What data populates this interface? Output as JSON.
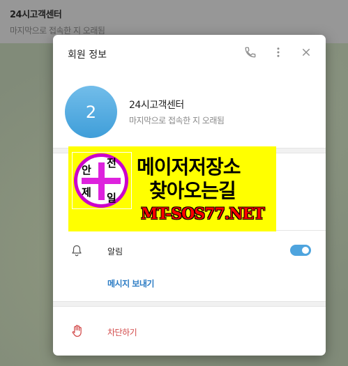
{
  "chat_header": {
    "title": "24시고객센터",
    "status": "마지막으로 접속한 지 오래됨"
  },
  "dialog": {
    "title": "회원 정보",
    "icons": {
      "phone": "phone-icon",
      "more": "more-vertical-icon",
      "close": "close-icon"
    }
  },
  "profile": {
    "avatar_initial": "2",
    "name": "24시고객센터",
    "status": "마지막으로 접속한 지 오래됨",
    "avatar_color": "#4aa6dd"
  },
  "banner": {
    "badge_chars": [
      "안",
      "전",
      "제",
      "일"
    ],
    "line1": "메이저저장소",
    "line2": "찾아오는길",
    "line3": "MT-SOS77.NET"
  },
  "notifications": {
    "label": "알림",
    "enabled": true
  },
  "send_message": {
    "label": "메시지 보내기"
  },
  "block": {
    "label": "차단하기"
  },
  "colors": {
    "accent": "#4ea4de",
    "link": "#2c7cc4",
    "danger": "#d24a4a",
    "banner_bg": "#ffff00",
    "badge": "#cc00cc"
  }
}
